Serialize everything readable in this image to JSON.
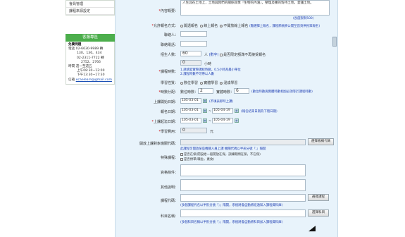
{
  "sidebar": {
    "menu": [
      "會員管理",
      "課程來源設定"
    ],
    "service": {
      "header": "客服專區",
      "title": "免費問題",
      "lines": [
        "電話 02-6630-9989 轉",
        "130、136、434",
        "02-2311-7722 轉",
        "2752、2766",
        "時間 週一至週五",
        "上午08:30~12:00",
        "下午13:30~17:30"
      ],
      "mail_label": "信箱",
      "mail": "ecaelearn@gmail.com"
    }
  },
  "form": {
    "content_text": "人生涯在土地上，土地與我們的關係就像『生物的內涵』，整理及審的對待土地，愛護土地。",
    "content_label": "內容概要：",
    "content_limit": "(長度限制500)",
    "signup_label": "允許報名方式：",
    "signup_options": [
      "開透報名",
      "線上報名",
      "不開放線上報名"
    ],
    "signup_selected": 2,
    "signup_note": "(難選擇上報名，課程節員將公開至首頁供民眾報名)",
    "contact_label": "聯絡人：",
    "phone_label": "聯絡電話：",
    "quota_label": "招生人數：",
    "quota_value": "60",
    "quota_unit": "人",
    "quota_hint": "(數字)",
    "quota_check": "是否限定額滿不再接受報名",
    "hours_label": "課程時數：",
    "hours_value": "0",
    "hours_unit": "小時",
    "hours_notes": [
      "1.請填寫實際課程時數，0.5小時為最小單位",
      "2.課程時數不可帶以人數"
    ],
    "study_label": "學習性質：",
    "study_options": [
      "數位學習",
      "實體學習",
      "混成學習"
    ],
    "study_selected": 2,
    "split_label": "時數分配：",
    "split_digital_label": "數位時數：",
    "split_digital_value": "2",
    "split_physical_label": "實體時數：",
    "split_physical_value": "6",
    "split_note": "(數位時數與實體時數相加必須等於課程時數)",
    "online_label": "上課開始日期：",
    "online_date": "105-03-01",
    "online_note": "(不填表即時上課)",
    "signup_date_label": "報名日期：",
    "signup_date_from": "105-03-01",
    "signup_date_to": "105-04-19",
    "signup_date_note": "(報名結束日期為下階日期)",
    "course_date_label": "上課起迄日期：",
    "course_date_from": "105-03-01",
    "course_date_to": "105-04-19",
    "fee_label": "學習費用：",
    "fee_value": "0",
    "fee_unit": "元",
    "org_label": "開放上課對象機關代碼：",
    "org_button": "選擇機構代碼",
    "org_note": "此課程可開放某些機關人員上課 機關代碼以半形分號『;』隔開",
    "special_label": "特殊課程：",
    "special_checks": [
      "是否在保(開設給一般開放在保，訓練期間在保，不在保)",
      "是否供單(職舍，素食)"
    ],
    "qual_label": "資格條件：",
    "other_label": "其他說明：",
    "code_label": "課程代碼：",
    "code_button": "選擇課程",
    "code_note": "(多個課程代名以半形分號『;』隔開，系統將會自動將班通知入課程資料庫)",
    "subject_label": "科目名稱：",
    "subject_button": "選擇科目",
    "subject_note": "(多個科目名稱以半形分號『;』隔開，系統將會自動將科目加入課程資料庫)",
    "arrow": "▾"
  }
}
